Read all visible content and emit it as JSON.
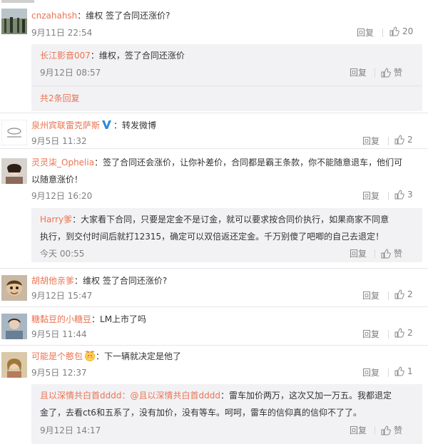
{
  "colors": {
    "username": "#eb7350",
    "text": "#333333",
    "meta": "#808080",
    "reply_bg": "#f2f2f5",
    "verified_blue": "#2f8bd4"
  },
  "comments": [
    {
      "user": "cnzahahsh",
      "text": "：维权 签了合同还涨价?",
      "time": "9月11日 22:54",
      "reply_label": "回复",
      "likes": "20",
      "sub": {
        "user": "长江影音007",
        "text": "：维权，签了合同还涨价",
        "time": "9月12日 08:57",
        "reply_label": "回复",
        "like_label": "赞"
      },
      "more": "共2条回复"
    },
    {
      "user": "泉州宾联雷克萨斯",
      "text": "：转发微博",
      "time": "9月5日 11:32",
      "reply_label": "回复",
      "likes": "2",
      "avatar_text": "泉州宾联"
    },
    {
      "user": "灵灵柒_Ophelia",
      "text_line1": "：签了合同还会涨价，让你补差价，合同都是霸王条款，你不能随意退车，他们可",
      "text_line2": "以随意涨价！",
      "time": "9月12日 16:20",
      "reply_label": "回复",
      "likes": "3",
      "sub": {
        "user": "Harry爹",
        "text_line1": "：大家看下合同，只要是定金不是订金，就可以要求按合同价执行，如果商家不同意",
        "text_line2": "执行，到交付时间后就打12315，确定可以双倍返还定金。千万别傻了吧唧的自己去退定！",
        "time": "今天 00:55",
        "reply_label": "回复",
        "like_label": "赞"
      }
    },
    {
      "user": "胡胡他亲爹",
      "text": "：维权 签了合同还涨价?",
      "time": "9月12日 15:47",
      "reply_label": "回复",
      "likes": "2"
    },
    {
      "user": "糖黏豆的小糖豆",
      "text": "：LM上市了吗",
      "time": "9月5日 11:44",
      "reply_label": "回复",
      "likes": "2"
    },
    {
      "user": "可能是个憨包",
      "text": "：下一辆就决定是他了",
      "time": "9月5日 12:37",
      "reply_label": "回复",
      "likes": "1",
      "sub": {
        "user": "且以深情共白首dddd",
        "mention": "：@且以深情共白首dddd",
        "text_line1": "：雷车加价两万，这次又加一万五。我都退定",
        "text_line2": "金了，去看ct6和五系了，没有加价，没有等车。呵呵，雷车的信仰真的信仰不了了。",
        "time": "9月12日 14:17",
        "reply_label": "回复",
        "like_label": "赞"
      }
    }
  ]
}
